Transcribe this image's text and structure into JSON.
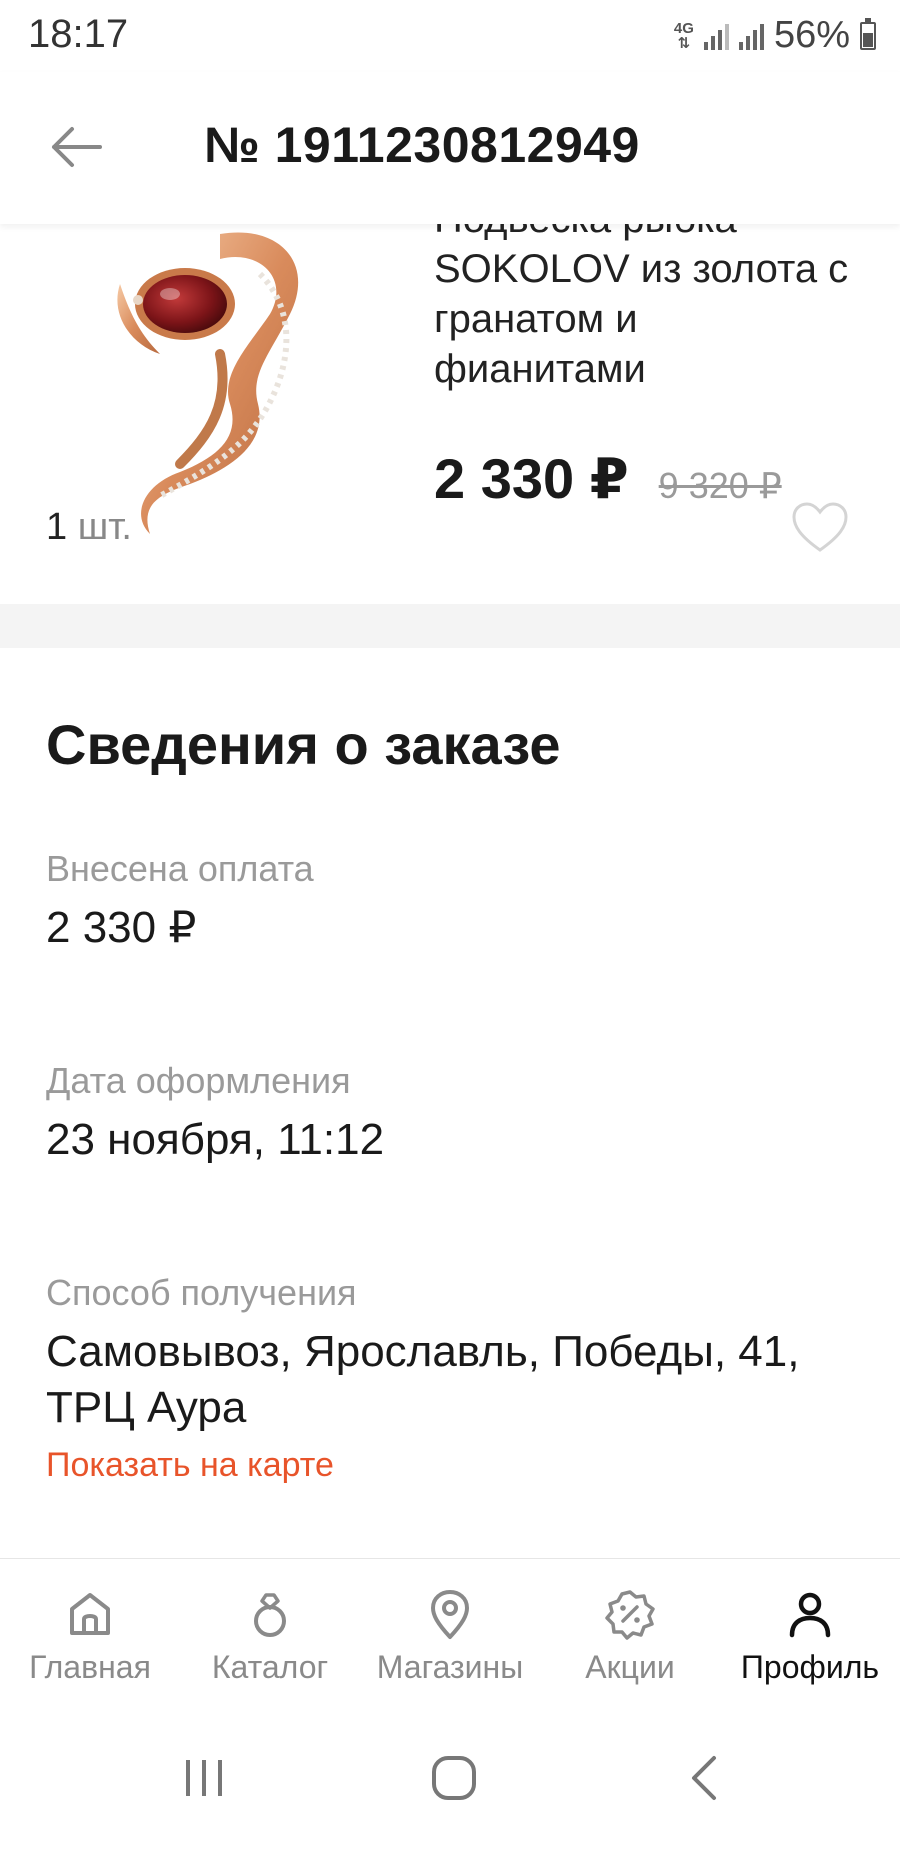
{
  "status_bar": {
    "time": "18:17",
    "network": "4G",
    "battery": "56%",
    "battery_level": 0.56
  },
  "header": {
    "title": "№ 1911230812949",
    "back_icon": "arrow-left-icon"
  },
  "product": {
    "name": "Подвеска рыбка SOKOLOV из золота с гранатом и фианитами",
    "price": "2 330 ₽",
    "old_price": "9 320 ₽",
    "quantity": "1",
    "quantity_unit": "шт.",
    "favorite_icon": "heart-outline-icon"
  },
  "order_details": {
    "title": "Сведения о заказе",
    "payment_label": "Внесена оплата",
    "payment_value": "2 330 ₽",
    "date_label": "Дата оформления",
    "date_value": "23 ноября, 11:12",
    "delivery_label": "Способ получения",
    "delivery_value": "Самовывоз, Ярославль, Победы, 41, ТРЦ Аура",
    "map_link": "Показать на карте"
  },
  "bottom_nav": {
    "items": [
      {
        "label": "Главная",
        "icon": "home-icon",
        "active": false
      },
      {
        "label": "Каталог",
        "icon": "ring-icon",
        "active": false
      },
      {
        "label": "Магазины",
        "icon": "map-pin-icon",
        "active": false
      },
      {
        "label": "Акции",
        "icon": "discount-badge-icon",
        "active": false
      },
      {
        "label": "Профиль",
        "icon": "user-icon",
        "active": true
      }
    ]
  },
  "colors": {
    "accent": "#e8542a",
    "text": "#1a1a1a",
    "muted": "#9a9a9a"
  }
}
